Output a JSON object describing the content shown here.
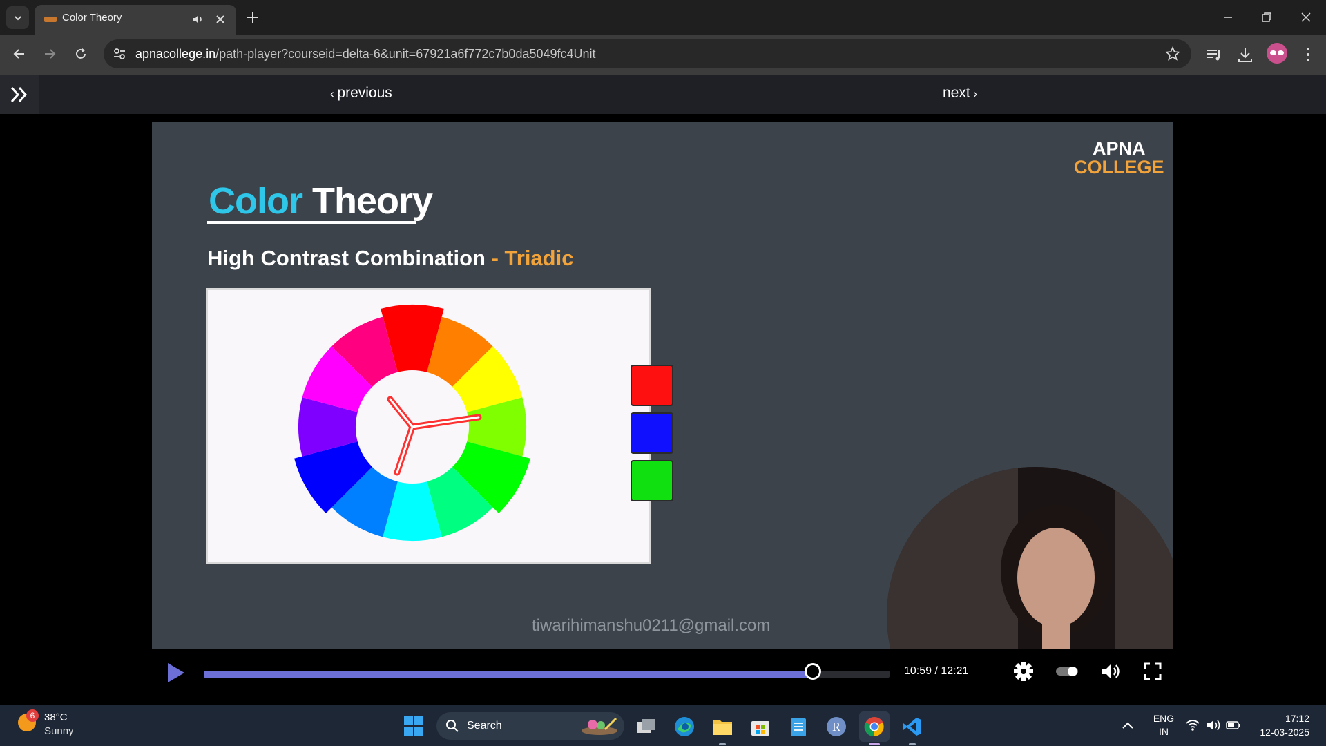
{
  "browser": {
    "tab": {
      "title": "Color Theory"
    },
    "url": {
      "domain": "apnacollege.in",
      "path": "/path-player?courseid=delta-6&unit=67921a6f772c7b0da5049fc4Unit"
    }
  },
  "page_nav": {
    "previous_label": "previous",
    "next_label": "next"
  },
  "slide": {
    "logo_line1": "APNA",
    "logo_line2": "COLLEGE",
    "title_word1": "Color",
    "title_word2": "Theory",
    "subtitle_main": "High Contrast Combination ",
    "subtitle_accent": "- Triadic",
    "triadic_colors": [
      "#ff1010",
      "#1010ff",
      "#10e010"
    ],
    "watermark": "tiwarihimanshu0211@gmail.com"
  },
  "player": {
    "time_label": "10:59 / 12:21",
    "progress_fraction": 0.888,
    "accent_color": "#6b6fd6"
  },
  "taskbar": {
    "weather_badge": "6",
    "weather_temp": "38°C",
    "weather_condition": "Sunny",
    "search_label": "Search",
    "lang_line1": "ENG",
    "lang_line2": "IN",
    "clock_time": "17:12",
    "clock_date": "12-03-2025",
    "apps": [
      "task-view-icon",
      "edge-icon",
      "file-explorer-icon",
      "microsoft-store-icon",
      "notepad-icon",
      "r-app-icon",
      "chrome-icon",
      "vscode-icon"
    ]
  }
}
